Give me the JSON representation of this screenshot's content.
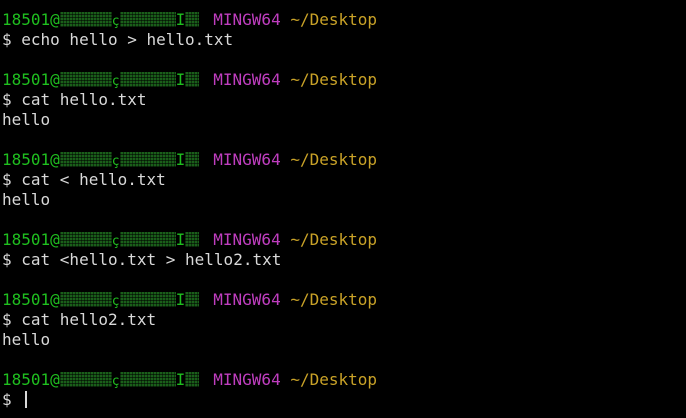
{
  "theme": {
    "background": "#000000",
    "user_color": "#1fbf1f",
    "host_color": "#c03ec0",
    "path_color": "#c9a227",
    "text_color": "#d9d9d9"
  },
  "prompt": {
    "user_prefix": "18501@",
    "redact_mid": "ç",
    "redact_mid2": "I",
    "host": "MINGW64",
    "path": "~/Desktop",
    "symbol": "$ "
  },
  "blocks": [
    {
      "command": "echo hello > hello.txt",
      "output": null
    },
    {
      "command": "cat hello.txt",
      "output": "hello"
    },
    {
      "command": "cat < hello.txt",
      "output": "hello"
    },
    {
      "command": "cat <hello.txt > hello2.txt",
      "output": null
    },
    {
      "command": "cat hello2.txt",
      "output": "hello"
    }
  ],
  "final_prompt": {
    "symbol": "$ "
  }
}
